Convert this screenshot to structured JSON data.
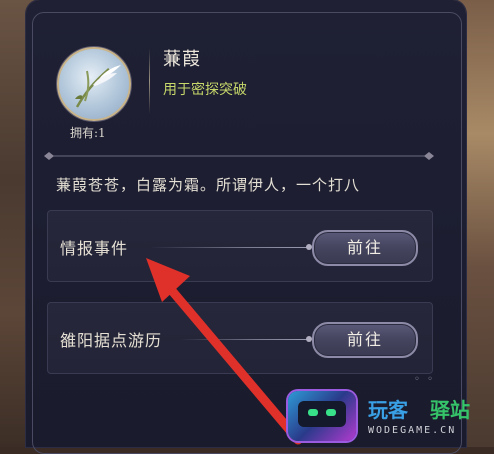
{
  "item": {
    "name": "蒹葭",
    "short_desc": "用于密探突破",
    "own_label": "拥有:1",
    "flavor": "蒹葭苍苍，白露为霜。所谓伊人，一个打八"
  },
  "sources": [
    {
      "label": "情报事件",
      "button": "前往"
    },
    {
      "label": "雒阳据点游历",
      "button": "前往"
    }
  ],
  "watermark": {
    "text1": "玩客",
    "text2": "驿站",
    "url": "WODEGAME.CN"
  },
  "colors": {
    "accent_desc": "#c8d86a",
    "arrow": "#e0302a"
  }
}
